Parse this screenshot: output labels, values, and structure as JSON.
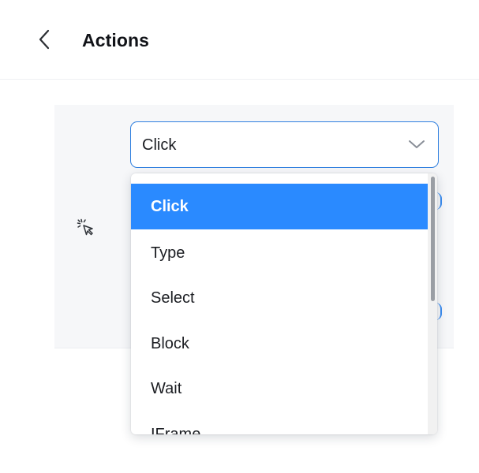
{
  "header": {
    "title": "Actions"
  },
  "select": {
    "value": "Click"
  },
  "dropdown": {
    "options": [
      "Click",
      "Type",
      "Select",
      "Block",
      "Wait",
      "IFrame"
    ],
    "selected": "Click"
  },
  "icons": {
    "back": "chevron-left-icon",
    "action": "cursor-click-icon",
    "select_toggle": "chevron-down-icon"
  },
  "colors": {
    "accent": "#2a8aff",
    "select_border": "#2f7fdf",
    "panel_bg": "#f6f7f9",
    "text": "#111318"
  }
}
